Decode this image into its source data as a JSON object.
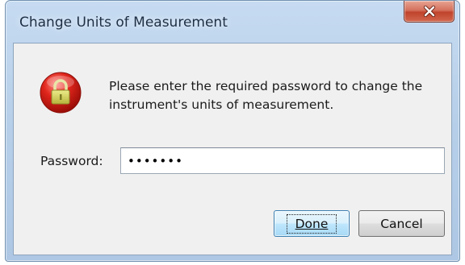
{
  "window": {
    "title": "Change Units of Measurement"
  },
  "titlebar": {
    "close_icon": "close-icon"
  },
  "dialog": {
    "icon": "lock-icon",
    "message": "Please enter the required password to change the instrument's units of measurement.",
    "password_label": "Password:",
    "password_value": "•••••••",
    "buttons": {
      "done_label": "Done",
      "cancel_label": "Cancel"
    }
  },
  "colors": {
    "titlebar": "#b7cfe9",
    "close_button": "#c0432c",
    "lock_badge": "#d8201a",
    "lock_body": "#d4d25a",
    "default_button": "#bee6fd"
  }
}
